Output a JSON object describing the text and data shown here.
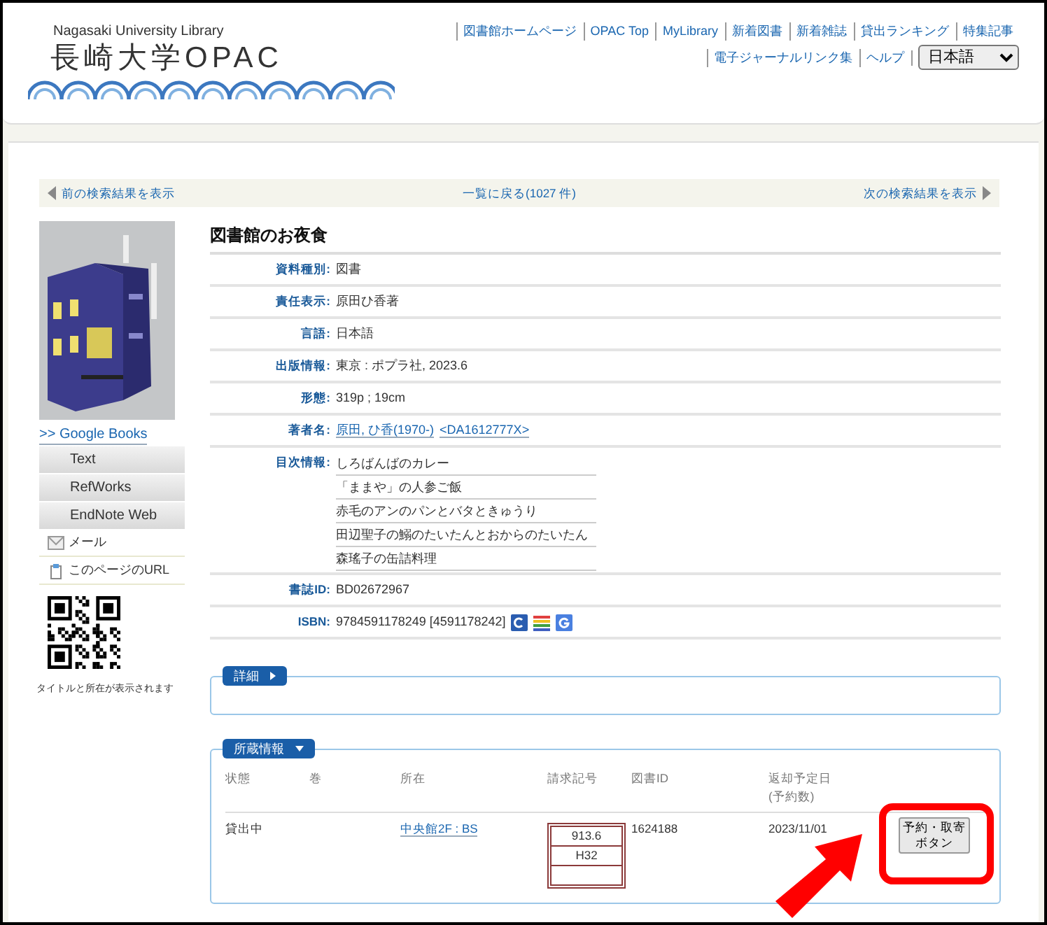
{
  "header": {
    "org": "Nagasaki University Library",
    "logo": "長崎大学OPAC",
    "links": [
      {
        "label": "図書館ホームページ"
      },
      {
        "label": "OPAC Top"
      },
      {
        "label": "MyLibrary"
      },
      {
        "label": "新着図書"
      },
      {
        "label": "新着雑誌"
      },
      {
        "label": "貸出ランキング"
      },
      {
        "label": "特集記事"
      },
      {
        "label": "電子ジャーナルリンク集"
      },
      {
        "label": "ヘルプ"
      }
    ],
    "language": "日本語"
  },
  "nav": {
    "prev": "前の検索結果を表示",
    "back": "一覧に戻る(1027 件)",
    "next": "次の検索結果を表示"
  },
  "sidebar": {
    "google_books": ">> Google Books",
    "exports": [
      "Text",
      "RefWorks",
      "EndNote Web"
    ],
    "actions": [
      {
        "kind": "mail",
        "label": "メール"
      },
      {
        "kind": "url",
        "label": "このページのURL"
      }
    ],
    "qr_caption": "タイトルと所在が表示されます"
  },
  "record": {
    "title": "図書館のお夜食",
    "fields": [
      {
        "label": "資料種別:",
        "kind": "text",
        "values": [
          "図書"
        ]
      },
      {
        "label": "責任表示:",
        "kind": "text",
        "values": [
          "原田ひ香著"
        ]
      },
      {
        "label": "言語:",
        "kind": "text",
        "values": [
          "日本語"
        ]
      },
      {
        "label": "出版情報:",
        "kind": "text",
        "values": [
          "東京 : ポプラ社, 2023.6"
        ]
      },
      {
        "label": "形態:",
        "kind": "text",
        "values": [
          "319p ; 19cm"
        ]
      },
      {
        "label": "著者名:",
        "kind": "links",
        "values": [
          "原田, ひ香(1970-)",
          "<DA1612777X>"
        ]
      },
      {
        "label": "目次情報:",
        "kind": "list",
        "values": [
          "しろばんばのカレー",
          "「ままや」の人参ご飯",
          "赤毛のアンのパンとバタときゅうり",
          "田辺聖子の鰯のたいたんとおからのたいたん",
          "森瑤子の缶詰料理"
        ]
      },
      {
        "label": "書誌ID:",
        "kind": "text",
        "values": [
          "BD02672967"
        ]
      },
      {
        "label": "ISBN:",
        "kind": "isbn",
        "values": [
          "9784591178249 [4591178242]"
        ]
      }
    ]
  },
  "details": {
    "label": "詳細",
    "expanded": false
  },
  "holdings": {
    "label": "所蔵情報",
    "expanded": true,
    "columns": [
      "状態",
      "巻",
      "所在",
      "請求記号",
      "図書ID",
      "返却予定日\n(予約数)"
    ],
    "rows": [
      {
        "status": "貸出中",
        "location": "中央館2F : BS",
        "call_number": [
          "913.6",
          "H32"
        ],
        "book_id": "1624188",
        "due": "2023/11/01",
        "button": [
          "予約・取寄",
          "ボタン"
        ]
      }
    ]
  }
}
